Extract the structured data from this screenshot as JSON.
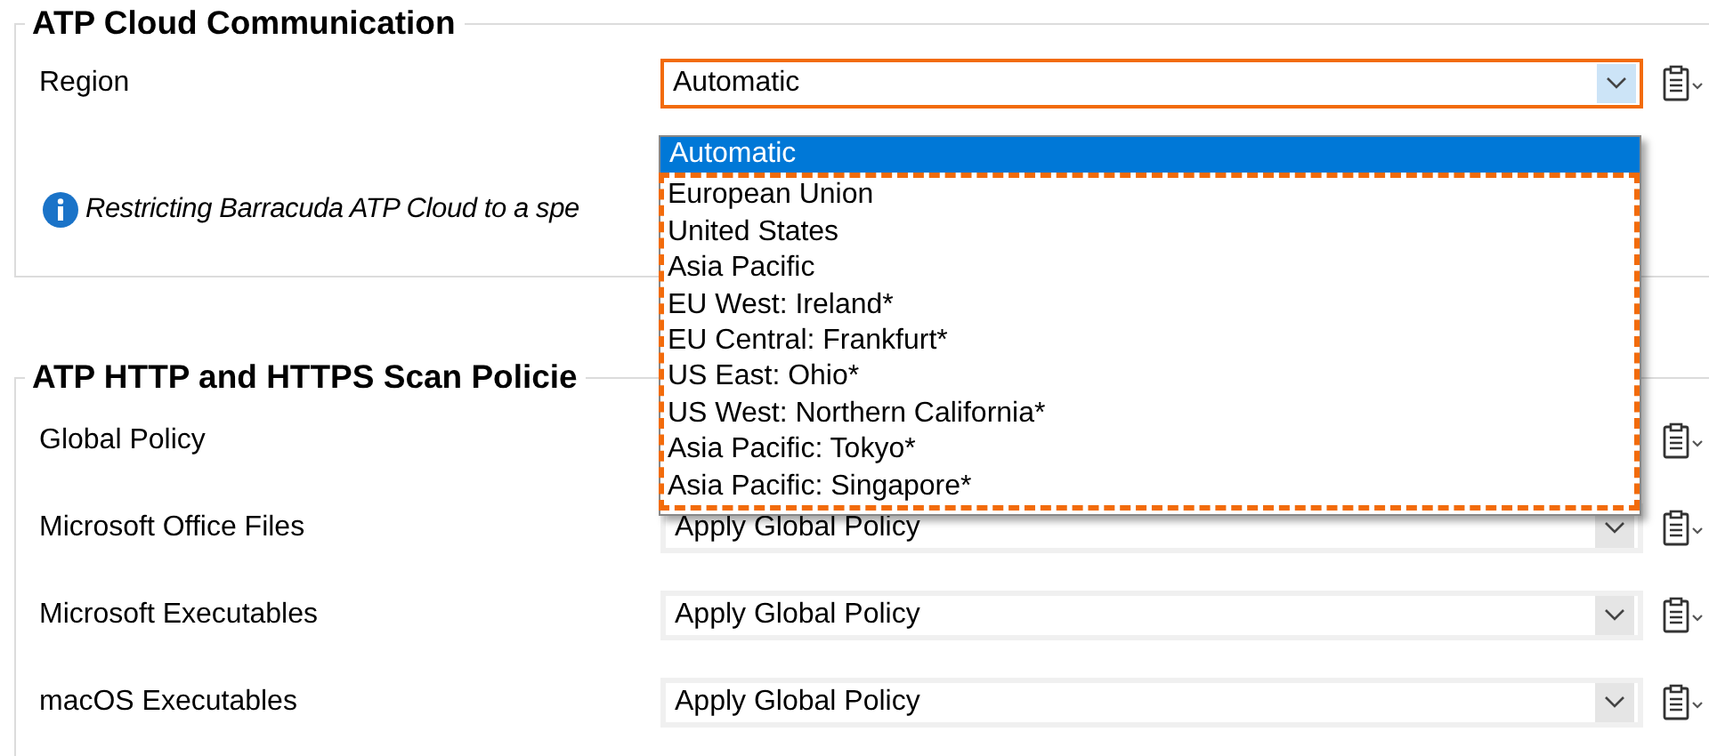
{
  "groups": [
    {
      "title": "ATP Cloud Communication",
      "rows": [
        {
          "kind": "combo",
          "label": "Region",
          "value": "Automatic",
          "expanded": true,
          "outlined": true
        }
      ],
      "info": "Restricting Barracuda ATP Cloud to a spe"
    },
    {
      "title": "ATP HTTP and HTTPS Scan Policie",
      "rows": [
        {
          "kind": "covered",
          "label": "Global Policy"
        },
        {
          "kind": "combo",
          "label": "Microsoft Office Files",
          "value": "Apply Global Policy",
          "expanded": false,
          "outlined": false
        },
        {
          "kind": "combo",
          "label": "Microsoft Executables",
          "value": "Apply Global Policy",
          "expanded": false,
          "outlined": false
        },
        {
          "kind": "combo",
          "label": "macOS Executables",
          "value": "Apply Global Policy",
          "expanded": false,
          "outlined": false
        }
      ]
    }
  ],
  "dropdown": {
    "options": [
      {
        "label": "Automatic",
        "selected": true,
        "outlined": false
      },
      {
        "label": "European Union",
        "selected": false,
        "outlined": true
      },
      {
        "label": "United States",
        "selected": false,
        "outlined": true
      },
      {
        "label": "Asia Pacific",
        "selected": false,
        "outlined": true
      },
      {
        "label": "EU West: Ireland*",
        "selected": false,
        "outlined": true
      },
      {
        "label": "EU Central: Frankfurt*",
        "selected": false,
        "outlined": true
      },
      {
        "label": "US East: Ohio*",
        "selected": false,
        "outlined": true
      },
      {
        "label": "US West: Northern California*",
        "selected": false,
        "outlined": true
      },
      {
        "label": "Asia Pacific: Tokyo*",
        "selected": false,
        "outlined": true
      },
      {
        "label": "Asia Pacific: Singapore*",
        "selected": false,
        "outlined": true
      }
    ]
  }
}
